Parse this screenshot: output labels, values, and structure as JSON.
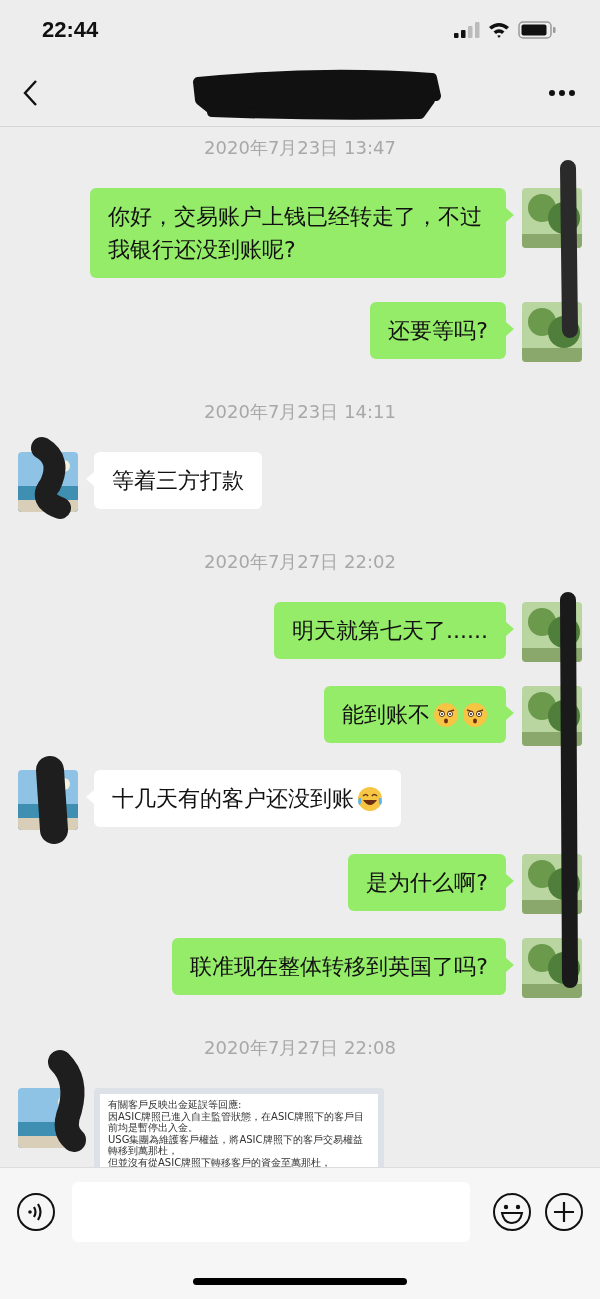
{
  "status_bar": {
    "time": "22:44"
  },
  "messages": [
    {
      "kind": "time",
      "text": "2020年7月23日 13:47"
    },
    {
      "kind": "text",
      "outgoing": true,
      "text": "你好，交易账户上钱已经转走了，不过我银行还没到账呢?"
    },
    {
      "kind": "text",
      "outgoing": true,
      "text": "还要等吗?"
    },
    {
      "kind": "time",
      "text": "2020年7月23日 14:11"
    },
    {
      "kind": "text",
      "outgoing": false,
      "text": "等着三方打款"
    },
    {
      "kind": "time",
      "text": "2020年7月27日 22:02"
    },
    {
      "kind": "text",
      "outgoing": true,
      "text": "明天就第七天了......"
    },
    {
      "kind": "text",
      "outgoing": true,
      "text": "能到账不",
      "emojis": [
        {
          "kind": "astonished"
        },
        {
          "kind": "astonished"
        }
      ]
    },
    {
      "kind": "text",
      "outgoing": false,
      "text": "十几天有的客户还没到账",
      "emojis": [
        {
          "kind": "laughing"
        }
      ]
    },
    {
      "kind": "text",
      "outgoing": true,
      "text": "是为什么啊?"
    },
    {
      "kind": "text",
      "outgoing": true,
      "text": "联准现在整体转移到英国了吗?"
    },
    {
      "kind": "time",
      "text": "2020年7月27日 22:08"
    },
    {
      "outgoing": false,
      "lines": [
        "有關客戶反映出金延誤等回應:",
        "因ASIC牌照已進入自主監管狀態，在ASIC牌照下的客戶目前均是暫停出入金。",
        "USG集團為維護客戶權益，將ASIC牌照下的客戶交易權益轉移到萬那杜，",
        "但並沒有從ASIC牌照下轉移客戶的資金至萬那杜，"
      ]
    }
  ]
}
